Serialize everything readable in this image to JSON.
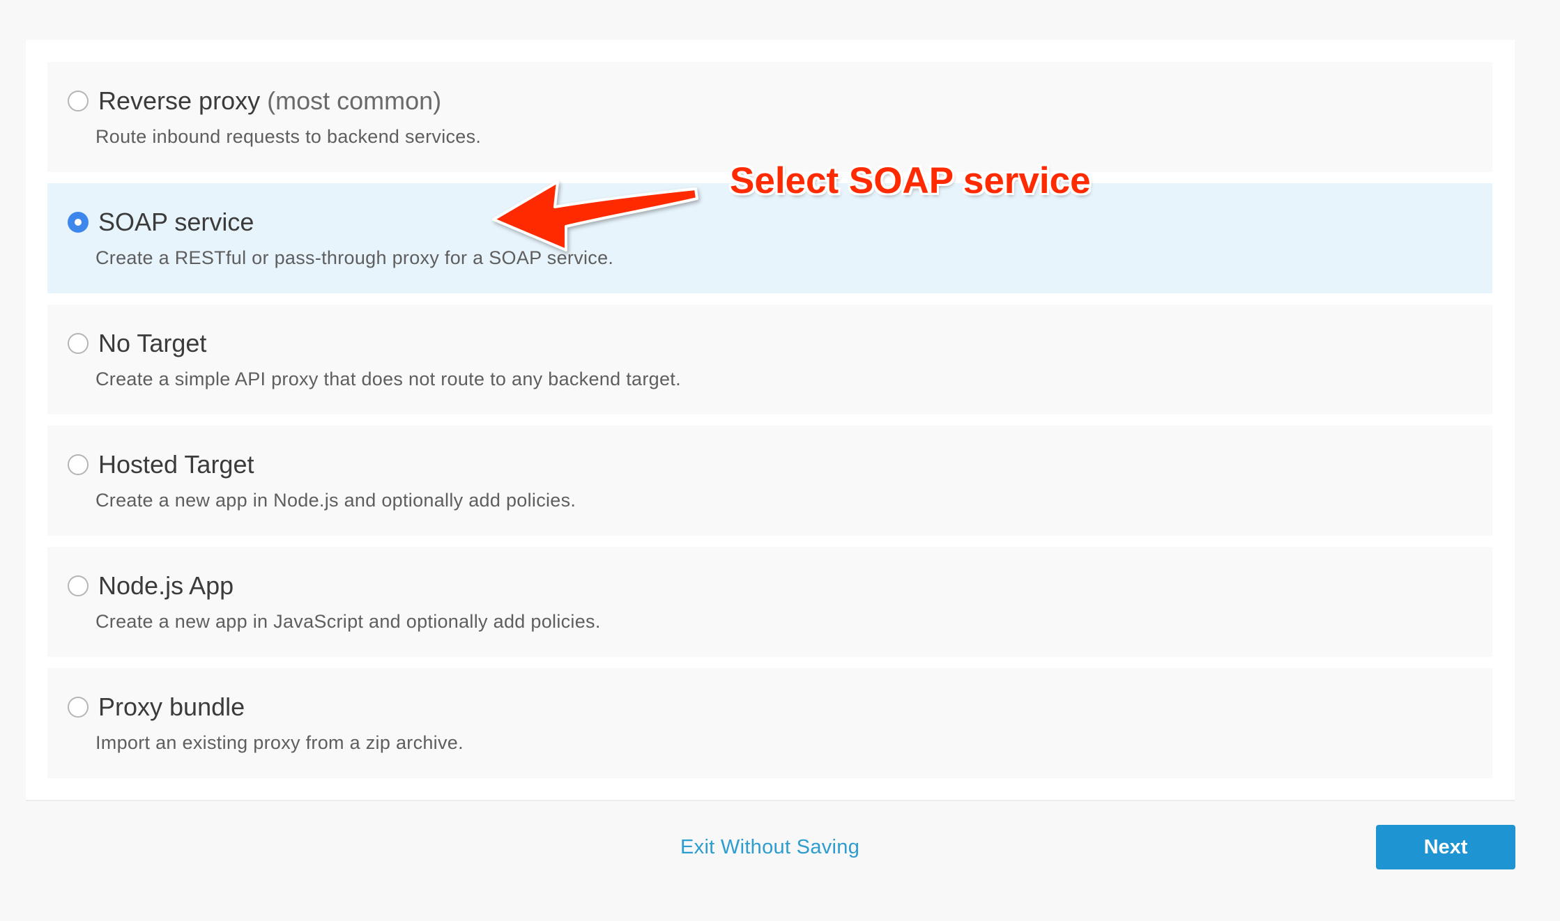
{
  "options": [
    {
      "title": "Reverse proxy",
      "suffix": "(most common)",
      "description": "Route inbound requests to backend services.",
      "selected": false
    },
    {
      "title": "SOAP service",
      "suffix": "",
      "description": "Create a RESTful or pass-through proxy for a SOAP service.",
      "selected": true
    },
    {
      "title": "No Target",
      "suffix": "",
      "description": "Create a simple API proxy that does not route to any backend target.",
      "selected": false
    },
    {
      "title": "Hosted Target",
      "suffix": "",
      "description": "Create a new app in Node.js and optionally add policies.",
      "selected": false
    },
    {
      "title": "Node.js App",
      "suffix": "",
      "description": "Create a new app in JavaScript and optionally add policies.",
      "selected": false
    },
    {
      "title": "Proxy bundle",
      "suffix": "",
      "description": "Import an existing proxy from a zip archive.",
      "selected": false
    }
  ],
  "annotation": {
    "text": "Select SOAP service",
    "color": "#ff2a00",
    "icon": "arrow-left-icon"
  },
  "footer": {
    "exit_label": "Exit Without Saving",
    "next_label": "Next"
  },
  "colors": {
    "accent": "#1e94d2",
    "link": "#2d9ccf",
    "selected_background": "#e8f4fc",
    "radio_checked": "#3d86ec"
  }
}
